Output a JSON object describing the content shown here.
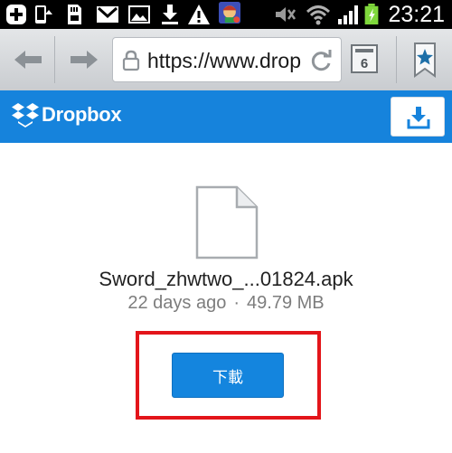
{
  "status_bar": {
    "time": "23:21",
    "icons": [
      "plus-icon",
      "phone-arrow-icon",
      "sd-card-icon",
      "mail-icon",
      "image-icon",
      "download-icon",
      "warning-icon",
      "app-avatar-icon",
      "mute-icon",
      "wifi-icon",
      "signal-icon",
      "battery-charging-icon"
    ]
  },
  "browser": {
    "url": "https://www.drop",
    "tab_count": "6"
  },
  "header": {
    "app_name": "Dropbox",
    "accent_color": "#1683dc"
  },
  "file": {
    "name": "Sword_zhwtwo_...01824.apk",
    "modified": "22 days ago",
    "separator": "·",
    "size": "49.79 MB"
  },
  "download_button": {
    "label": "下載"
  },
  "highlight_color": "#e3151a"
}
